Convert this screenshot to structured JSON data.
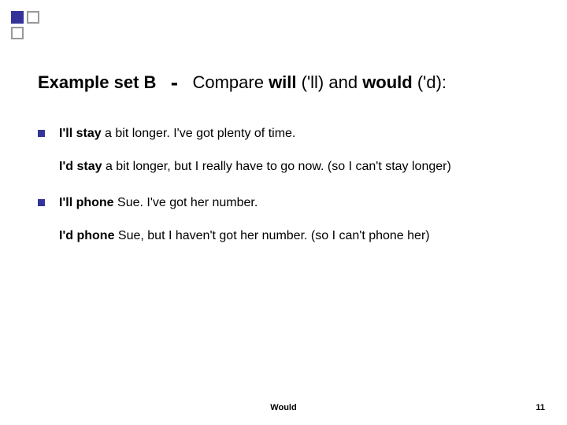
{
  "title": {
    "part1": "Example set B",
    "dash": "-",
    "part2_a": "Compare ",
    "part2_b": "will",
    "part2_c": " ('ll) and ",
    "part2_d": "would",
    "part2_e": " ('d):"
  },
  "items": [
    {
      "line1_bold": "I'll stay",
      "line1_rest": " a bit longer. I've got plenty of time.",
      "line2_bold": "I'd stay",
      "line2_rest": " a bit longer, but  I really have to go now.  (so I can't stay longer)"
    },
    {
      "line1_bold": "I'll phone",
      "line1_rest": " Sue. I've got her number.",
      "line2_bold": "I'd phone",
      "line2_rest": " Sue, but I haven't got her number.  (so I can't phone her)"
    }
  ],
  "footer": {
    "center": "Would",
    "page": "11"
  }
}
